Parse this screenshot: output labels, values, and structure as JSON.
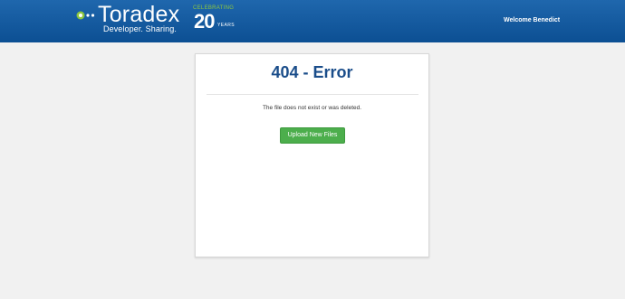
{
  "header": {
    "logo": {
      "wordmark": "Toradex",
      "tagline": "Developer. Sharing."
    },
    "anniversary_badge": {
      "top": "CELEBRATING",
      "number": "20",
      "bottom": "YEARS"
    },
    "welcome_text": "Welcome Benedict"
  },
  "error_card": {
    "title": "404 - Error",
    "message": "The file does not exist or was deleted.",
    "upload_button_label": "Upload New Files"
  },
  "colors": {
    "header_blue": "#0c4f93",
    "title_blue": "#1a4d8a",
    "accent_green": "#8dc63f",
    "button_green": "#4cae4c"
  }
}
